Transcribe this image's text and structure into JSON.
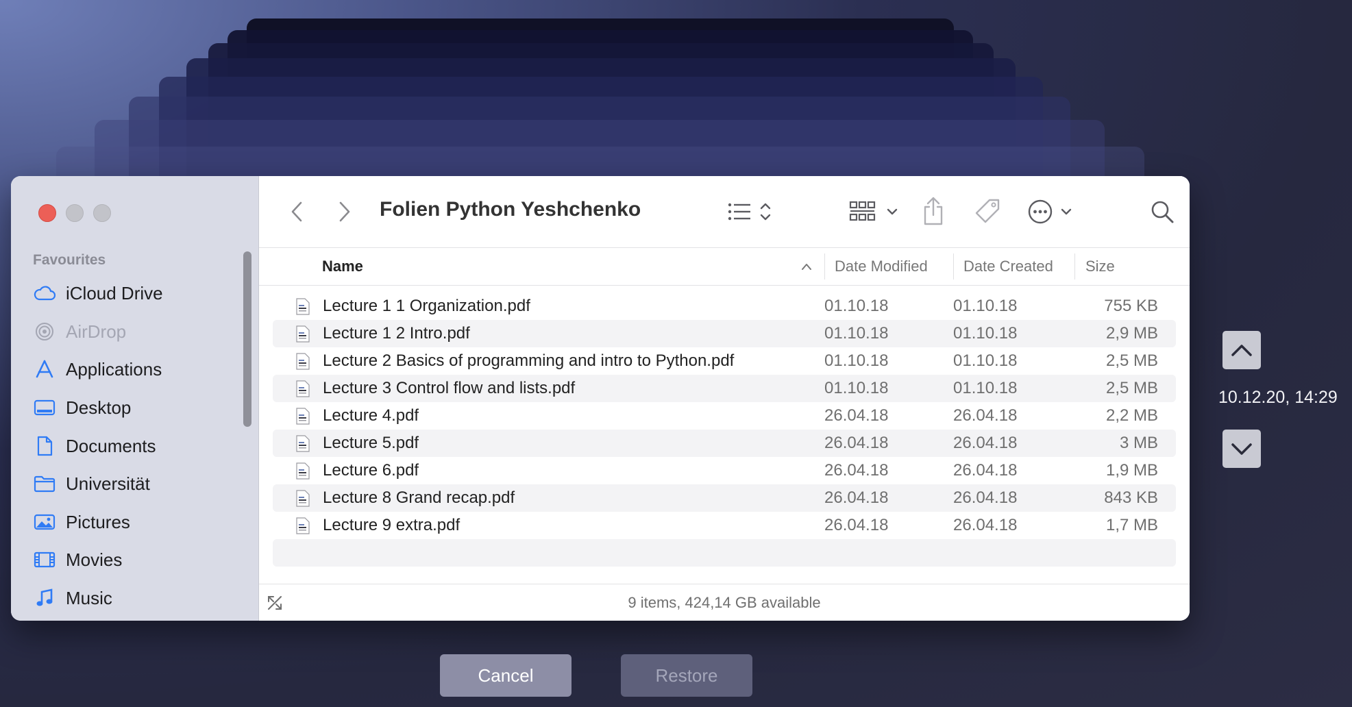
{
  "window": {
    "title": "Folien Python Yeshchenko",
    "traffic_lights": [
      "close",
      "minimize",
      "zoom"
    ]
  },
  "sidebar": {
    "section_title": "Favourites",
    "items": [
      {
        "label": "iCloud Drive",
        "icon": "cloud-icon"
      },
      {
        "label": "AirDrop",
        "icon": "airdrop-icon",
        "dimmed": true
      },
      {
        "label": "Applications",
        "icon": "applications-icon"
      },
      {
        "label": "Desktop",
        "icon": "desktop-icon"
      },
      {
        "label": "Documents",
        "icon": "document-icon"
      },
      {
        "label": "Universität",
        "icon": "folder-icon"
      },
      {
        "label": "Pictures",
        "icon": "pictures-icon"
      },
      {
        "label": "Movies",
        "icon": "film-icon"
      },
      {
        "label": "Music",
        "icon": "music-note-icon"
      }
    ]
  },
  "toolbar": {
    "icons": [
      "back-icon",
      "forward-icon",
      "list-view-icon",
      "group-by-icon",
      "share-icon",
      "tag-icon",
      "more-actions-icon",
      "search-icon"
    ]
  },
  "columns": {
    "name": "Name",
    "modified": "Date Modified",
    "created": "Date Created",
    "size": "Size"
  },
  "files": [
    {
      "name": "Lecture 1 1 Organization.pdf",
      "modified": "01.10.18",
      "created": "01.10.18",
      "size": "755 KB"
    },
    {
      "name": "Lecture 1 2 Intro.pdf",
      "modified": "01.10.18",
      "created": "01.10.18",
      "size": "2,9 MB"
    },
    {
      "name": "Lecture 2 Basics of programming and intro to Python.pdf",
      "modified": "01.10.18",
      "created": "01.10.18",
      "size": "2,5 MB"
    },
    {
      "name": "Lecture 3 Control flow and lists.pdf",
      "modified": "01.10.18",
      "created": "01.10.18",
      "size": "2,5 MB"
    },
    {
      "name": "Lecture 4.pdf",
      "modified": "26.04.18",
      "created": "26.04.18",
      "size": "2,2 MB"
    },
    {
      "name": "Lecture 5.pdf",
      "modified": "26.04.18",
      "created": "26.04.18",
      "size": "3 MB"
    },
    {
      "name": "Lecture 6.pdf",
      "modified": "26.04.18",
      "created": "26.04.18",
      "size": "1,9 MB"
    },
    {
      "name": "Lecture 8 Grand recap.pdf",
      "modified": "26.04.18",
      "created": "26.04.18",
      "size": "843 KB"
    },
    {
      "name": "Lecture 9 extra.pdf",
      "modified": "26.04.18",
      "created": "26.04.18",
      "size": "1,7 MB"
    }
  ],
  "status": {
    "text": "9 items, 424,14 GB available"
  },
  "time_machine": {
    "timestamp": "10.12.20, 14:29",
    "cancel_label": "Cancel",
    "restore_label": "Restore"
  },
  "colors": {
    "close": "#ec5f57",
    "sidebar_bg": "#d9dbe6",
    "accent_icon": "#2f7bf5",
    "cancel_bg": "#8d8ea6",
    "restore_bg": "#5e607b"
  }
}
